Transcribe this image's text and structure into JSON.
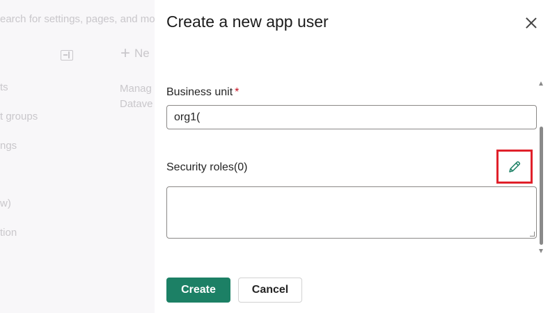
{
  "background": {
    "search_placeholder": "earch for settings, pages, and mo",
    "new_label": "Ne",
    "nav_items": [
      "ts",
      "t groups",
      "ngs",
      "w)",
      "tion"
    ],
    "description_lines": [
      "Manag",
      "Datave"
    ]
  },
  "dialog": {
    "title": "Create a new app user",
    "business_unit": {
      "label": "Business unit",
      "required_marker": "*",
      "value": "org1("
    },
    "security_roles": {
      "label": "Security roles(0)",
      "value": ""
    },
    "buttons": {
      "create": "Create",
      "cancel": "Cancel"
    },
    "colors": {
      "primary": "#1c8065",
      "highlight_border": "#e0202a",
      "required": "#c50f1f"
    },
    "icons": {
      "close": "close-icon",
      "edit": "pencil-icon"
    }
  }
}
